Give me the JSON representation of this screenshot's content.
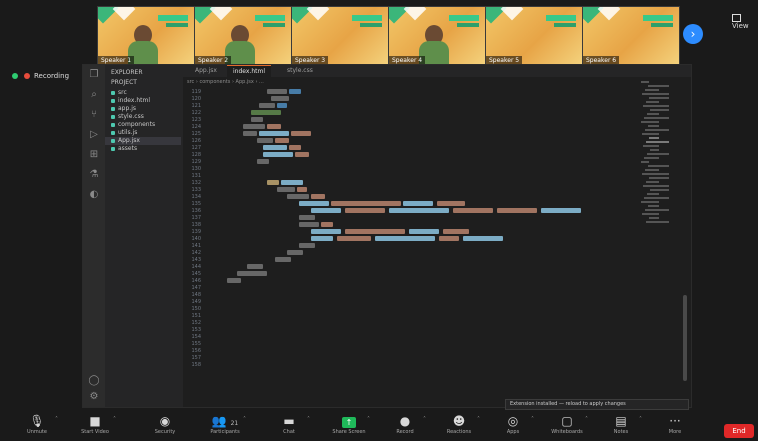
{
  "meeting": {
    "recording_label": "Recording",
    "view_label": "View",
    "gallery_next": "›",
    "participants": [
      {
        "name": "Speaker 1"
      },
      {
        "name": "Speaker 2"
      },
      {
        "name": "Speaker 3"
      },
      {
        "name": "Speaker 4"
      },
      {
        "name": "Speaker 5"
      },
      {
        "name": "Speaker 6"
      }
    ],
    "end_label": "End"
  },
  "toolbar": {
    "items": [
      {
        "icon": "microphone-icon",
        "glyph": "🎙",
        "label": "Unmute"
      },
      {
        "icon": "video-camera-icon",
        "glyph": "■",
        "label": "Start Video"
      },
      {
        "icon": "shield-icon",
        "glyph": "◉",
        "label": "Security"
      },
      {
        "icon": "participants-icon",
        "glyph": "👥",
        "label": "Participants",
        "badge": "21"
      },
      {
        "icon": "chat-icon",
        "glyph": "▬",
        "label": "Chat"
      },
      {
        "icon": "share-screen-icon",
        "glyph": "↑",
        "label": "Share Screen"
      },
      {
        "icon": "record-icon",
        "glyph": "●",
        "label": "Record"
      },
      {
        "icon": "reactions-icon",
        "glyph": "☻",
        "label": "Reactions"
      },
      {
        "icon": "apps-icon",
        "glyph": "◎",
        "label": "Apps"
      },
      {
        "icon": "whiteboard-icon",
        "glyph": "▢",
        "label": "Whiteboards"
      },
      {
        "icon": "notes-icon",
        "glyph": "▤",
        "label": "Notes"
      },
      {
        "icon": "more-icon",
        "glyph": "···",
        "label": "More"
      }
    ]
  },
  "vscode": {
    "explorer_title": "EXPLORER",
    "project": "PROJECT",
    "tree": [
      {
        "label": "src"
      },
      {
        "label": "index.html"
      },
      {
        "label": "app.js"
      },
      {
        "label": "style.css"
      },
      {
        "label": "components"
      },
      {
        "label": "utils.js"
      },
      {
        "label": "App.jsx"
      },
      {
        "label": "assets"
      }
    ],
    "tabs": [
      {
        "label": "App.jsx"
      },
      {
        "label": "index.html"
      },
      {
        "label": "style.css"
      }
    ],
    "breadcrumb": "src › components › App.jsx › ...",
    "notification": "Extension installed — reload to apply changes"
  },
  "colors": {
    "accent": "#2d8cff",
    "share_green": "#1fb95a",
    "end_red": "#e02828",
    "tab_active_border": "#e06b2b"
  }
}
